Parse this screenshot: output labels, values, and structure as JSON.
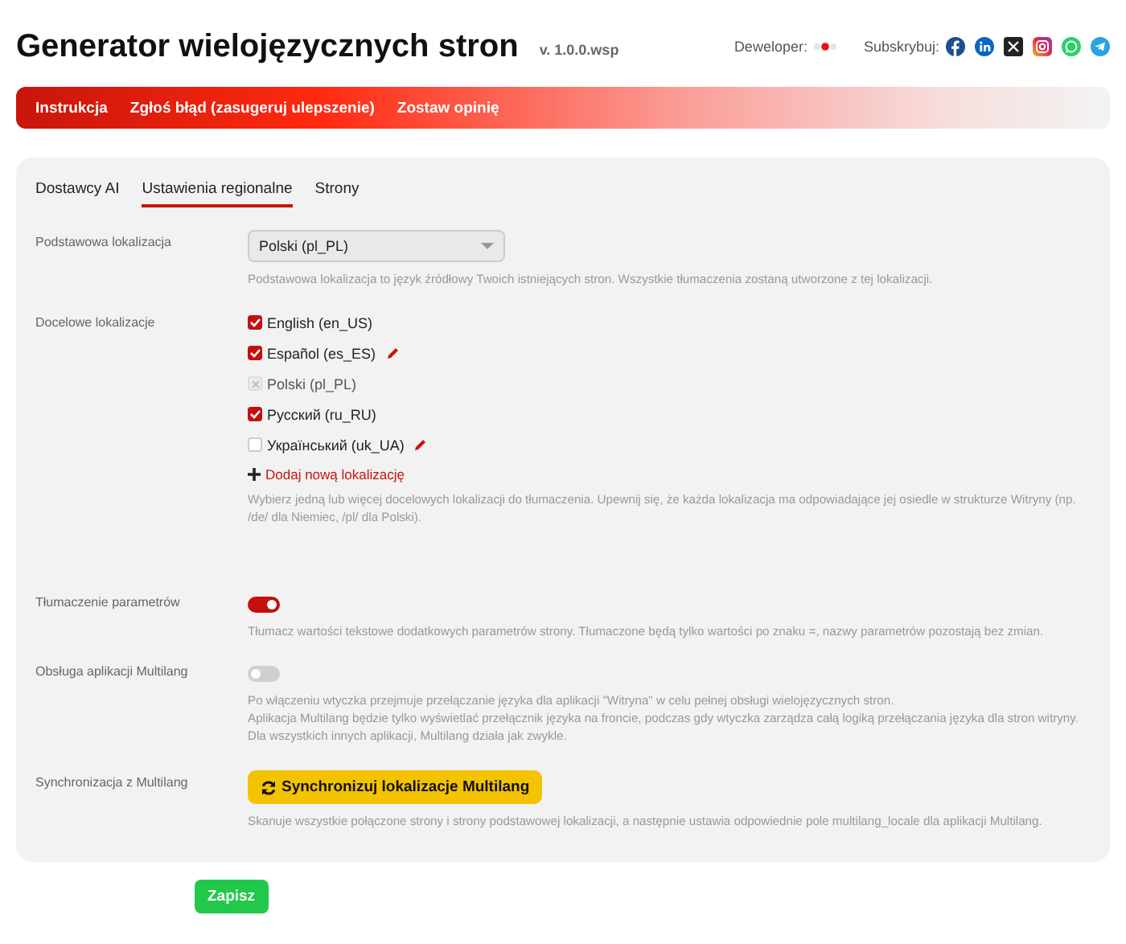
{
  "header": {
    "title": "Generator wielojęzycznych stron",
    "version": "v. 1.0.0.wsp",
    "developer_label": "Deweloper:",
    "subscribe_label": "Subskrybuj:"
  },
  "nav_links": [
    "Instrukcja",
    "Zgłoś błąd (zasugeruj ulepszenie)",
    "Zostaw opinię"
  ],
  "tabs": [
    {
      "label": "Dostawcy AI",
      "selected": false
    },
    {
      "label": "Ustawienia regionalne",
      "selected": true
    },
    {
      "label": "Strony",
      "selected": false
    }
  ],
  "settings": [
    {
      "kind": "select",
      "label": "Podstawowa lokalizacja",
      "value": "Polski (pl_PL)",
      "description": [
        "Podstawowa lokalizacja to język źródłowy Twoich istniejących stron. Wszystkie tłumaczenia zostaną utworzone z tej lokalizacji."
      ]
    },
    {
      "kind": "checklist",
      "label": "Docelowe lokalizacje",
      "options": [
        {
          "label": "English (en_US)",
          "checked": true,
          "disabled": false,
          "editable": false
        },
        {
          "label": "Español (es_ES)",
          "checked": true,
          "disabled": false,
          "editable": true
        },
        {
          "label": "Polski (pl_PL)",
          "checked": false,
          "disabled": true,
          "editable": false
        },
        {
          "label": "Русский (ru_RU)",
          "checked": true,
          "disabled": false,
          "editable": false
        },
        {
          "label": "Український (uk_UA)",
          "checked": false,
          "disabled": false,
          "editable": true
        }
      ],
      "add_link": "Dodaj nową lokalizację",
      "description": [
        "Wybierz jedną lub więcej docelowych lokalizacji do tłumaczenia. Upewnij się, że każda lokalizacja ma odpowiadające jej osiedle w strukturze Witryny (np. /de/ dla Niemiec, /pl/ dla Polski)."
      ]
    },
    {
      "kind": "toggle",
      "label": "Tłumaczenie parametrów",
      "on": true,
      "description": [
        "Tłumacz wartości tekstowe dodatkowych parametrów strony. Tłumaczone będą tylko wartości po znaku =, nazwy parametrów pozostają bez zmian."
      ]
    },
    {
      "kind": "toggle",
      "label": "Obsługa aplikacji Multilang",
      "on": false,
      "description": [
        "Po włączeniu wtyczka przejmuje przełączanie języka dla aplikacji \"Witryna\" w celu pełnej obsługi wielojęzycznych stron.",
        "Aplikacja Multilang będzie tylko wyświetlać przełącznik języka na froncie, podczas gdy wtyczka zarządza całą logiką przełączania języka dla stron witryny.",
        "Dla wszystkich innych aplikacji, Multilang działa jak zwykle."
      ]
    },
    {
      "kind": "button",
      "label": "Synchronizacja z Multilang",
      "button": "Synchronizuj lokalizacje Multilang",
      "description": [
        "Skanuje wszystkie połączone strony i strony podstawowej lokalizacji, a następnie ustawia odpowiednie pole multilang_locale dla aplikacji Multilang."
      ]
    }
  ],
  "save_button": "Zapisz"
}
